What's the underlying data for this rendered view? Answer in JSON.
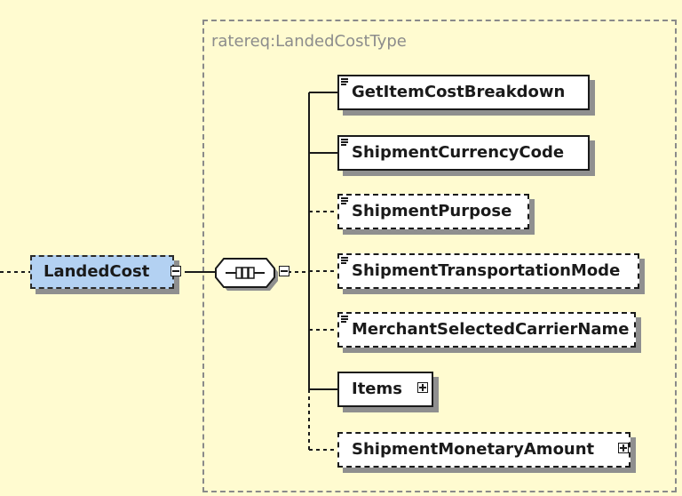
{
  "type_label": "ratereq:LandedCostType",
  "root": {
    "label": "LandedCost"
  },
  "compositor": {
    "kind": "sequence",
    "icon": "sequence-icon"
  },
  "children": [
    {
      "label": "GetItemCostBreakdown",
      "optional": false,
      "has_children": false
    },
    {
      "label": "ShipmentCurrencyCode",
      "optional": false,
      "has_children": false
    },
    {
      "label": "ShipmentPurpose",
      "optional": true,
      "has_children": false
    },
    {
      "label": "ShipmentTransportationMode",
      "optional": true,
      "has_children": false
    },
    {
      "label": "MerchantSelectedCarrierName",
      "optional": true,
      "has_children": false
    },
    {
      "label": "Items",
      "optional": false,
      "has_children": true
    },
    {
      "label": "ShipmentMonetaryAmount",
      "optional": true,
      "has_children": true
    }
  ],
  "colors": {
    "background": "#fffbd0",
    "root_fill": "#b3d1f2",
    "border": "#1a1a1a",
    "type_border": "#8a8a8a"
  }
}
